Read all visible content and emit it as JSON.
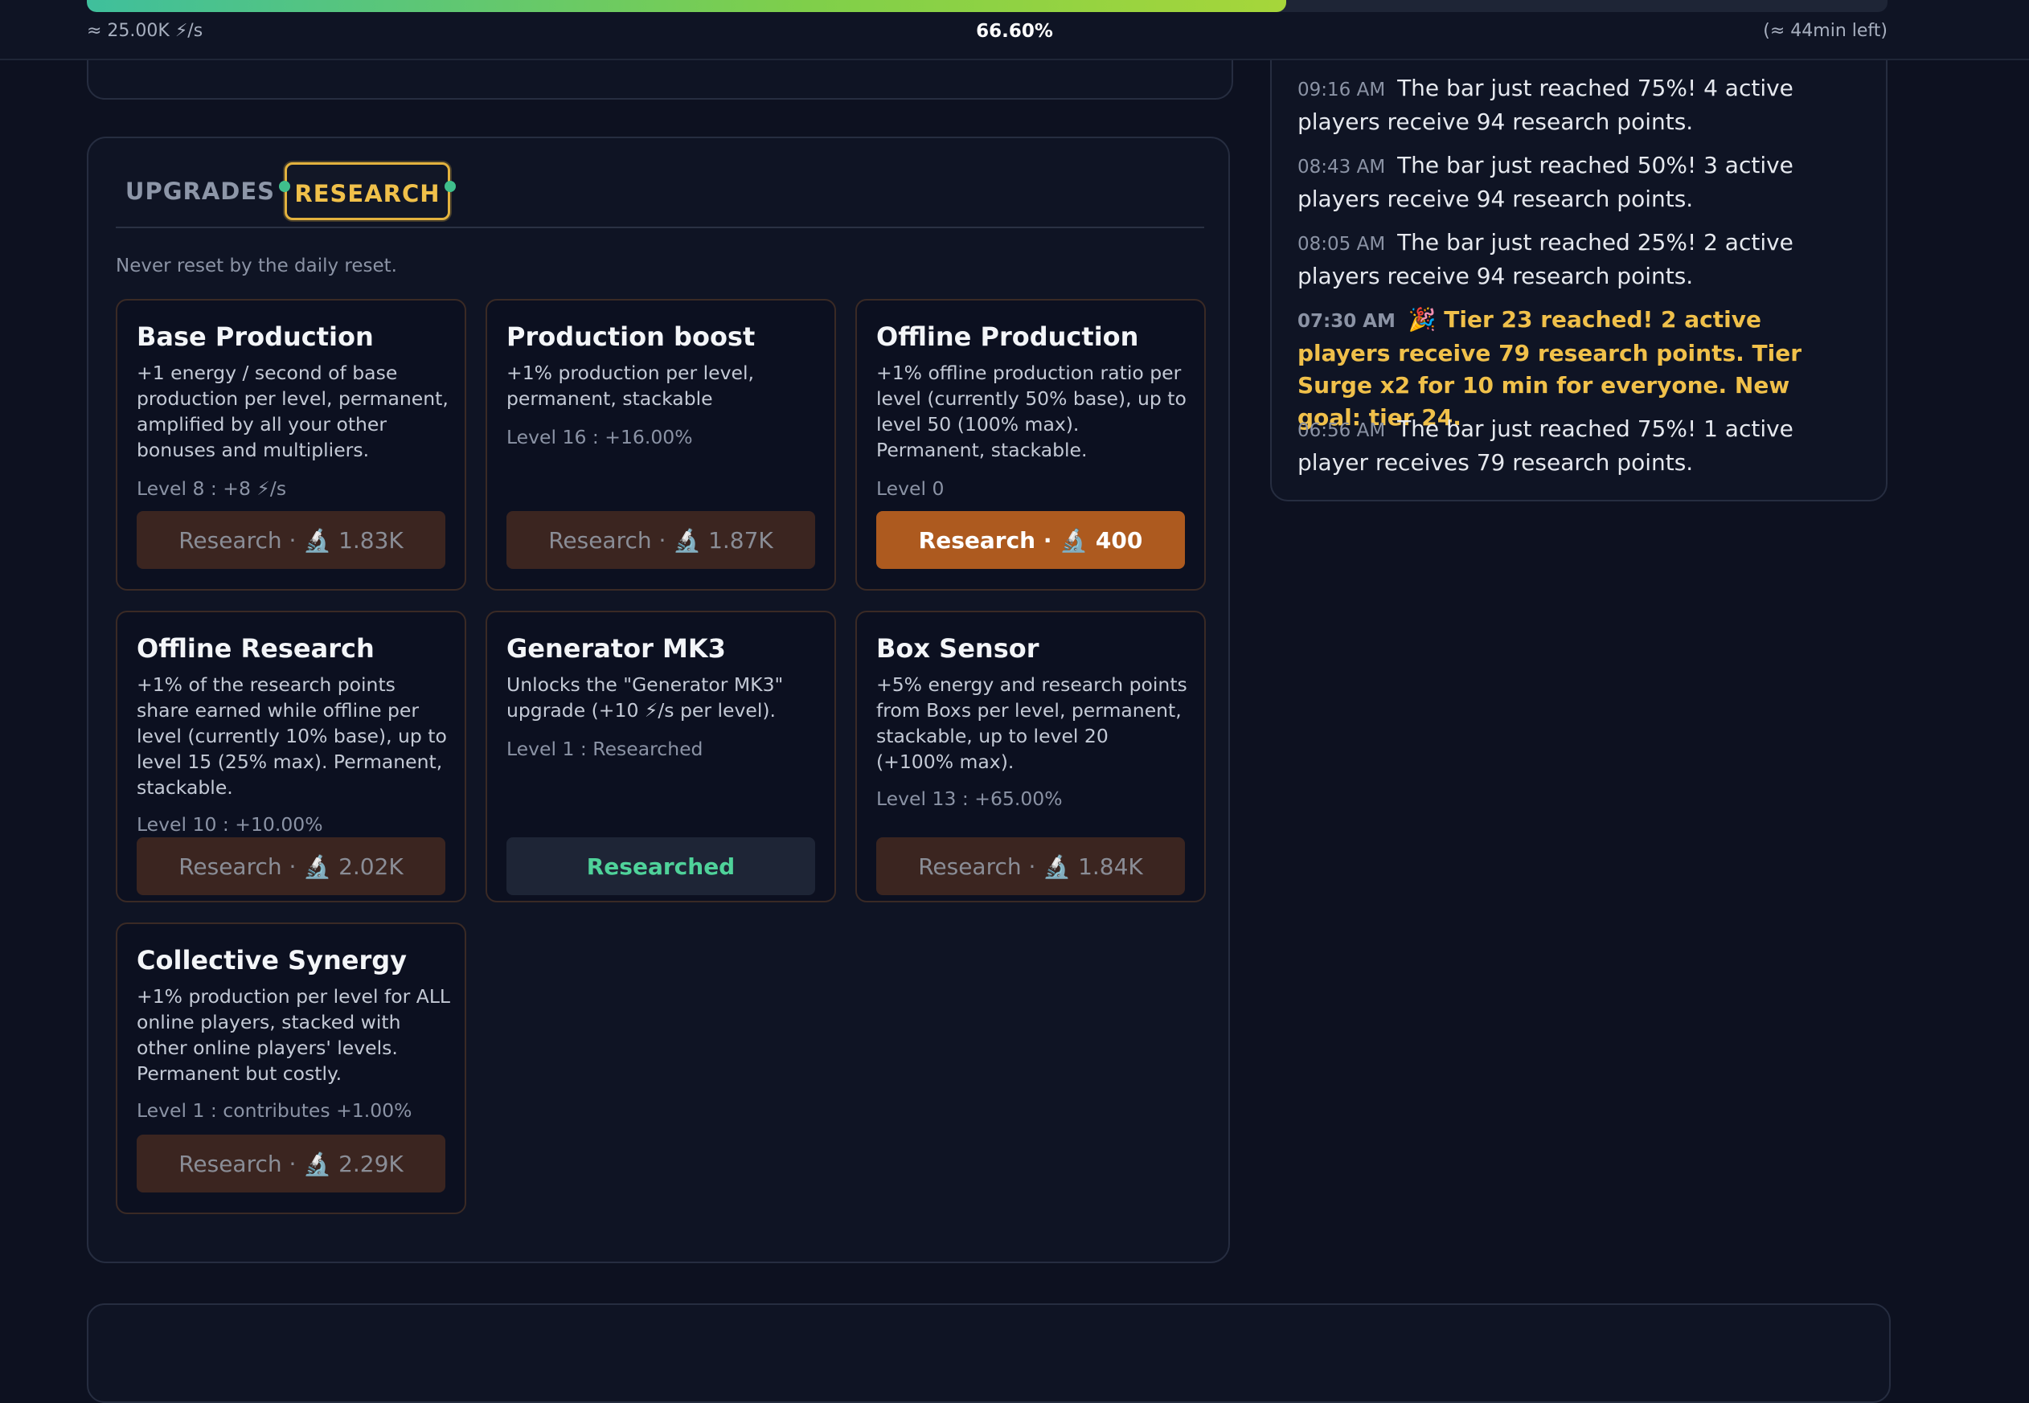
{
  "header": {
    "rate": "≈ 25.00K ⚡/s",
    "progress_label": "66.60%",
    "progress_fraction": 0.666,
    "time_left": "(≈ 44min left)"
  },
  "tabs": [
    {
      "label": "UPGRADES",
      "active": false
    },
    {
      "label": "RESEARCH",
      "active": true
    }
  ],
  "research": {
    "subtitle": "Never reset by the daily reset.",
    "cards": [
      {
        "title": "Base Production",
        "description": "+1 energy / second of base production per level, permanent, amplified by all your other bonuses and multipliers.",
        "level": "Level 8 : +8 ⚡/s",
        "button": "Research · 🔬 1.83K",
        "state": "disabled"
      },
      {
        "title": "Production boost",
        "description": "+1% production per level, permanent, stackable",
        "level": "Level 16 : +16.00%",
        "button": "Research · 🔬 1.87K",
        "state": "disabled"
      },
      {
        "title": "Offline Production",
        "description": "+1% offline production ratio per level (currently 50% base), up to level 50 (100% max). Permanent, stackable.",
        "level": "Level 0",
        "button": "Research · 🔬 400",
        "state": "active"
      },
      {
        "title": "Offline Research",
        "description": "+1% of the research points share earned while offline per level (currently 10% base), up to level 15 (25% max). Permanent, stackable.",
        "level": "Level 10 : +10.00%",
        "button": "Research · 🔬 2.02K",
        "state": "disabled"
      },
      {
        "title": "Generator MK3",
        "description": "Unlocks the \"Generator MK3\" upgrade (+10 ⚡/s per level).",
        "level": "Level 1 : Researched",
        "button": "Researched",
        "state": "done"
      },
      {
        "title": "Box Sensor",
        "description": "+5% energy and research points from Boxs per level, permanent, stackable, up to level 20 (+100% max).",
        "level": "Level 13 : +65.00%",
        "button": "Research · 🔬 1.84K",
        "state": "disabled"
      },
      {
        "title": "Collective Synergy",
        "description": "+1% production per level for ALL online players, stacked with other online players' levels. Permanent but costly.",
        "level": "Level 1 : contributes +1.00%",
        "button": "Research · 🔬 2.29K",
        "state": "disabled"
      }
    ]
  },
  "log": [
    {
      "time": "09:16 AM",
      "text": "The bar just reached 75%! 4 active players receive 94 research points.",
      "highlight": false
    },
    {
      "time": "08:43 AM",
      "text": "The bar just reached 50%! 3 active players receive 94 research points.",
      "highlight": false
    },
    {
      "time": "08:05 AM",
      "text": "The bar just reached 25%! 2 active players receive 94 research points.",
      "highlight": false
    },
    {
      "time": "07:30 AM",
      "text": "🎉 Tier 23 reached! 2 active players receive 79 research points. Tier Surge x2 for 10 min for everyone. New goal: tier 24.",
      "highlight": true
    },
    {
      "time": "06:56 AM",
      "text": "The bar just reached 75%! 1 active player receives 79 research points.",
      "highlight": false
    }
  ],
  "colors": {
    "accent_gold": "#f0c04a",
    "research_button": "#ad5a1f",
    "researched_green": "#4fd29a",
    "progress_green": "#7fcf4a"
  }
}
